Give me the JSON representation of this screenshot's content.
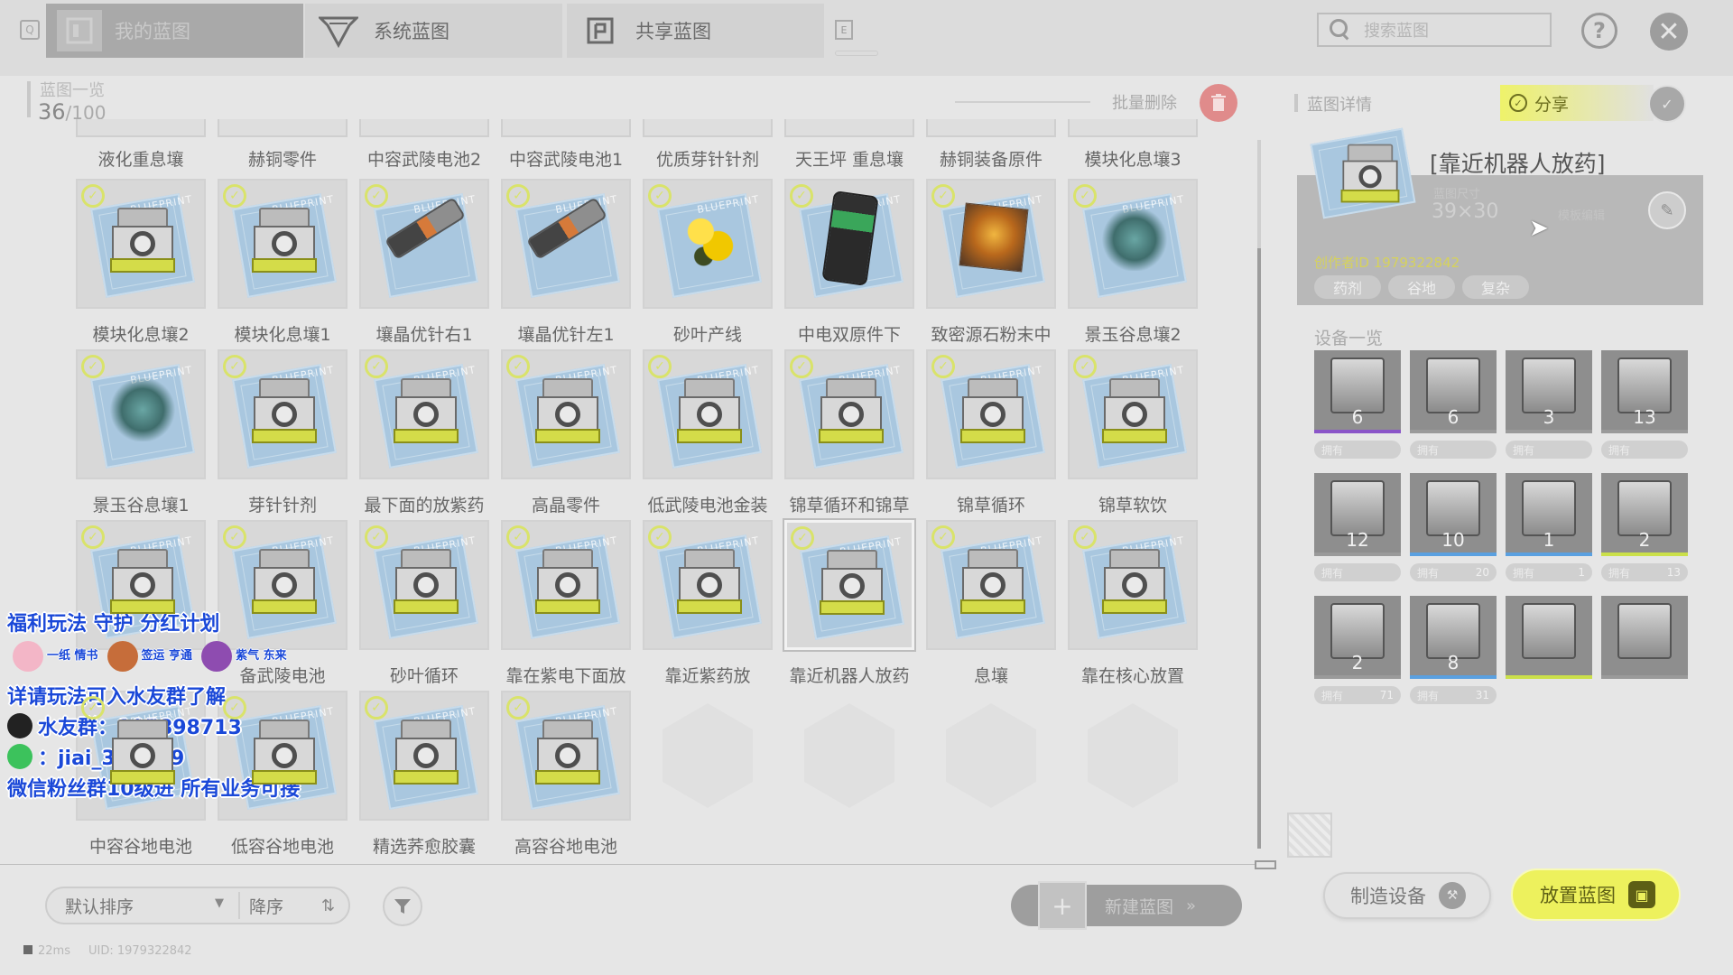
{
  "tabs": [
    {
      "label": "我的蓝图",
      "active": true
    },
    {
      "label": "系统蓝图",
      "active": false
    },
    {
      "label": "共享蓝图",
      "active": false
    }
  ],
  "tab_e_label": "E",
  "search": {
    "placeholder": "搜索蓝图"
  },
  "help_glyph": "?",
  "close_glyph": "✕",
  "list": {
    "title": "蓝图一览",
    "count": "36",
    "max": "/100",
    "batch_delete": "批量删除"
  },
  "row0_labels": [
    "液化重息壤",
    "赫铜零件",
    "中容武陵电池2",
    "中容武陵电池1",
    "优质芽针针剂",
    "天王坪 重息壤",
    "赫铜装备原件",
    "模块化息壤3"
  ],
  "blueprints": [
    {
      "label": "模块化息壤2",
      "art": "machine"
    },
    {
      "label": "模块化息壤1",
      "art": "machine"
    },
    {
      "label": "壤晶优针右1",
      "art": "gun"
    },
    {
      "label": "壤晶优针左1",
      "art": "gun"
    },
    {
      "label": "砂叶产线",
      "art": "flower"
    },
    {
      "label": "中电双原件下",
      "art": "robot"
    },
    {
      "label": "致密源石粉末中",
      "art": "cube"
    },
    {
      "label": "景玉谷息壤2",
      "art": "crystal"
    },
    {
      "label": "景玉谷息壤1",
      "art": "crystal"
    },
    {
      "label": "芽针针剂",
      "art": "machine"
    },
    {
      "label": "最下面的放紫药",
      "art": "machine"
    },
    {
      "label": "高晶零件",
      "art": "machine"
    },
    {
      "label": "低武陵电池金装",
      "art": "machine"
    },
    {
      "label": "锦草循环和锦草",
      "art": "machine"
    },
    {
      "label": "锦草循环",
      "art": "machine"
    },
    {
      "label": "锦草软饮",
      "art": "machine"
    },
    {
      "label": "",
      "art": "machine"
    },
    {
      "label": "备武陵电池",
      "art": "machine"
    },
    {
      "label": "砂叶循环",
      "art": "machine"
    },
    {
      "label": "靠在紫电下面放",
      "art": "machine"
    },
    {
      "label": "靠近紫药放",
      "art": "machine"
    },
    {
      "label": "靠近机器人放药",
      "art": "machine",
      "selected": true
    },
    {
      "label": "息壤",
      "art": "machine"
    },
    {
      "label": "靠在核心放置",
      "art": "machine"
    },
    {
      "label": "中容谷地电池",
      "art": "machine"
    },
    {
      "label": "低容谷地电池",
      "art": "machine"
    },
    {
      "label": "精选荞愈胶囊",
      "art": "machine"
    },
    {
      "label": "高容谷地电池",
      "art": "machine"
    }
  ],
  "blueprint_watermark": "BLUEPRINT",
  "check_glyph": "✓",
  "detail": {
    "section_title": "蓝图详情",
    "share_label": "分享",
    "title": "[靠近机器人放药]",
    "size_label": "蓝图尺寸",
    "size": "39×30",
    "faint_text": "模板编辑",
    "author": "创作者ID 1979322842",
    "tags": [
      "药剂",
      "谷地",
      "复杂"
    ],
    "devices_title": "设备一览",
    "own_label": "拥有",
    "devices": [
      {
        "count": "6",
        "accent": "#8a55c8",
        "own": ""
      },
      {
        "count": "6",
        "accent": "#9a9a9a",
        "own": ""
      },
      {
        "count": "3",
        "accent": "#9a9a9a",
        "own": ""
      },
      {
        "count": "13",
        "accent": "#9a9a9a",
        "own": ""
      },
      {
        "count": "12",
        "accent": "#9a9a9a",
        "own": ""
      },
      {
        "count": "10",
        "accent": "#5aa0e0",
        "own": "20"
      },
      {
        "count": "1",
        "accent": "#5aa0e0",
        "own": "1"
      },
      {
        "count": "2",
        "accent": "#cbe04a",
        "own": "13"
      },
      {
        "count": "2",
        "accent": "#9a9a9a",
        "own": "71"
      },
      {
        "count": "8",
        "accent": "#5aa0e0",
        "own": "31"
      },
      {
        "count": "",
        "accent": "#cbe04a",
        "own": null
      },
      {
        "count": "",
        "accent": "#9a9a9a",
        "own": null
      }
    ]
  },
  "overlay": {
    "line1": "福利玩法 守护 分红计划",
    "badge1": "一纸 情书",
    "badge2": "签运 亨通",
    "badge3": "紫气 东来",
    "line2": "详请玩法可入水友群了解",
    "line3": "水友群：105898713",
    "line4": "：jiai_326719",
    "line5": "微信粉丝群10级进 所有业务可接"
  },
  "bottom": {
    "sort_default": "默认排序",
    "sort_order": "降序",
    "new_blueprint": "新建蓝图",
    "make_device": "制造设备",
    "place_blueprint": "放置蓝图"
  },
  "status": {
    "ping": "22ms",
    "uid": "UID: 1979322842"
  },
  "colors": {
    "accent_yellow": "#edf15d",
    "delete_red": "#e08b8b",
    "overlay_blue": "#1a48d8"
  }
}
